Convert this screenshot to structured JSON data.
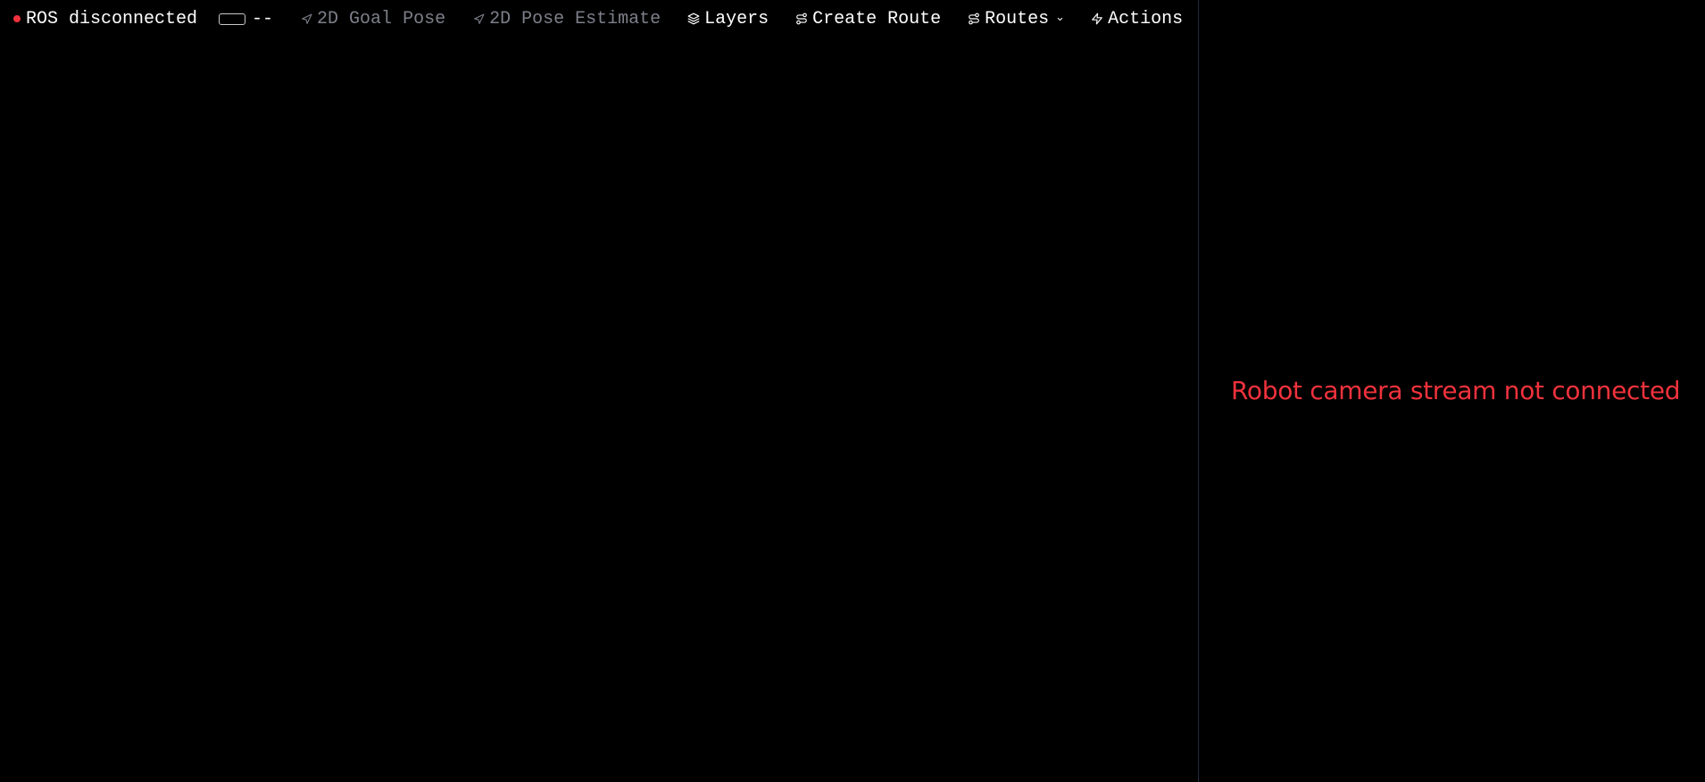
{
  "toolbar": {
    "ros_status": {
      "label": "ROS disconnected",
      "dot_color": "#f0323c"
    },
    "battery": {
      "value": "--"
    },
    "goal_pose": {
      "label": "2D Goal Pose",
      "icon": "navigation-arrow-icon",
      "enabled": false
    },
    "pose_estimate": {
      "label": "2D Pose Estimate",
      "icon": "navigation-arrow-icon",
      "enabled": false
    },
    "layers": {
      "label": "Layers",
      "icon": "layers-icon"
    },
    "create_route": {
      "label": "Create Route",
      "icon": "route-icon"
    },
    "routes": {
      "label": "Routes",
      "icon": "route-icon",
      "dropdown": true
    },
    "actions": {
      "label": "Actions",
      "icon": "zap-icon"
    }
  },
  "camera": {
    "message": "Robot camera stream not connected",
    "message_color": "#f0323c"
  },
  "colors": {
    "background": "#000000",
    "divider": "#1f2a44",
    "disabled_text": "#7d7f8a",
    "text": "#ffffff"
  }
}
